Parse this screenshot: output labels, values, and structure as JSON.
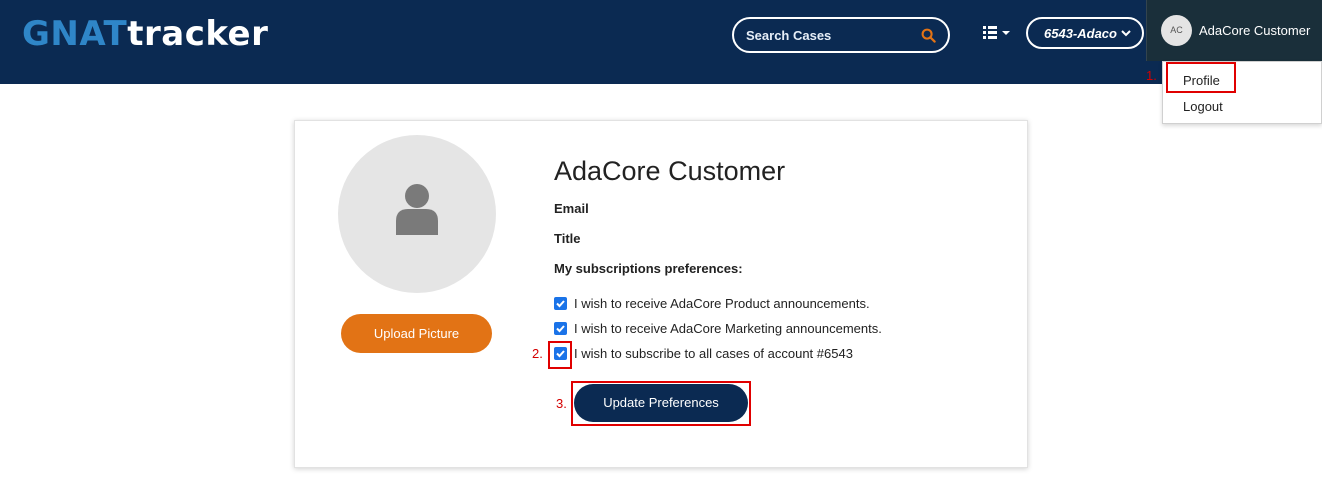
{
  "header": {
    "logo_part1": "GNAT",
    "logo_part2": "tracker",
    "search_placeholder": "Search Cases",
    "account_label": "6543-Adaco",
    "user_initials": "AC",
    "user_name": "AdaCore Customer"
  },
  "dropdown": {
    "items": [
      "Profile",
      "Logout"
    ]
  },
  "profile": {
    "name": "AdaCore Customer",
    "email_label": "Email",
    "title_label": "Title",
    "subscriptions_label": "My subscriptions preferences:",
    "upload_button": "Upload Picture",
    "update_button": "Update Preferences",
    "preferences": [
      {
        "label": "I wish to receive AdaCore Product announcements.",
        "checked": true
      },
      {
        "label": "I wish to receive AdaCore Marketing announcements.",
        "checked": true
      },
      {
        "label": "I wish to subscribe to all cases of account #6543",
        "checked": true
      }
    ]
  },
  "annotations": {
    "step1": "1.",
    "step2": "2.",
    "step3": "3."
  },
  "colors": {
    "header_bg": "#0b2a52",
    "accent_orange": "#e27315",
    "highlight_red": "#e00000",
    "checkbox_blue": "#1a73e8"
  }
}
